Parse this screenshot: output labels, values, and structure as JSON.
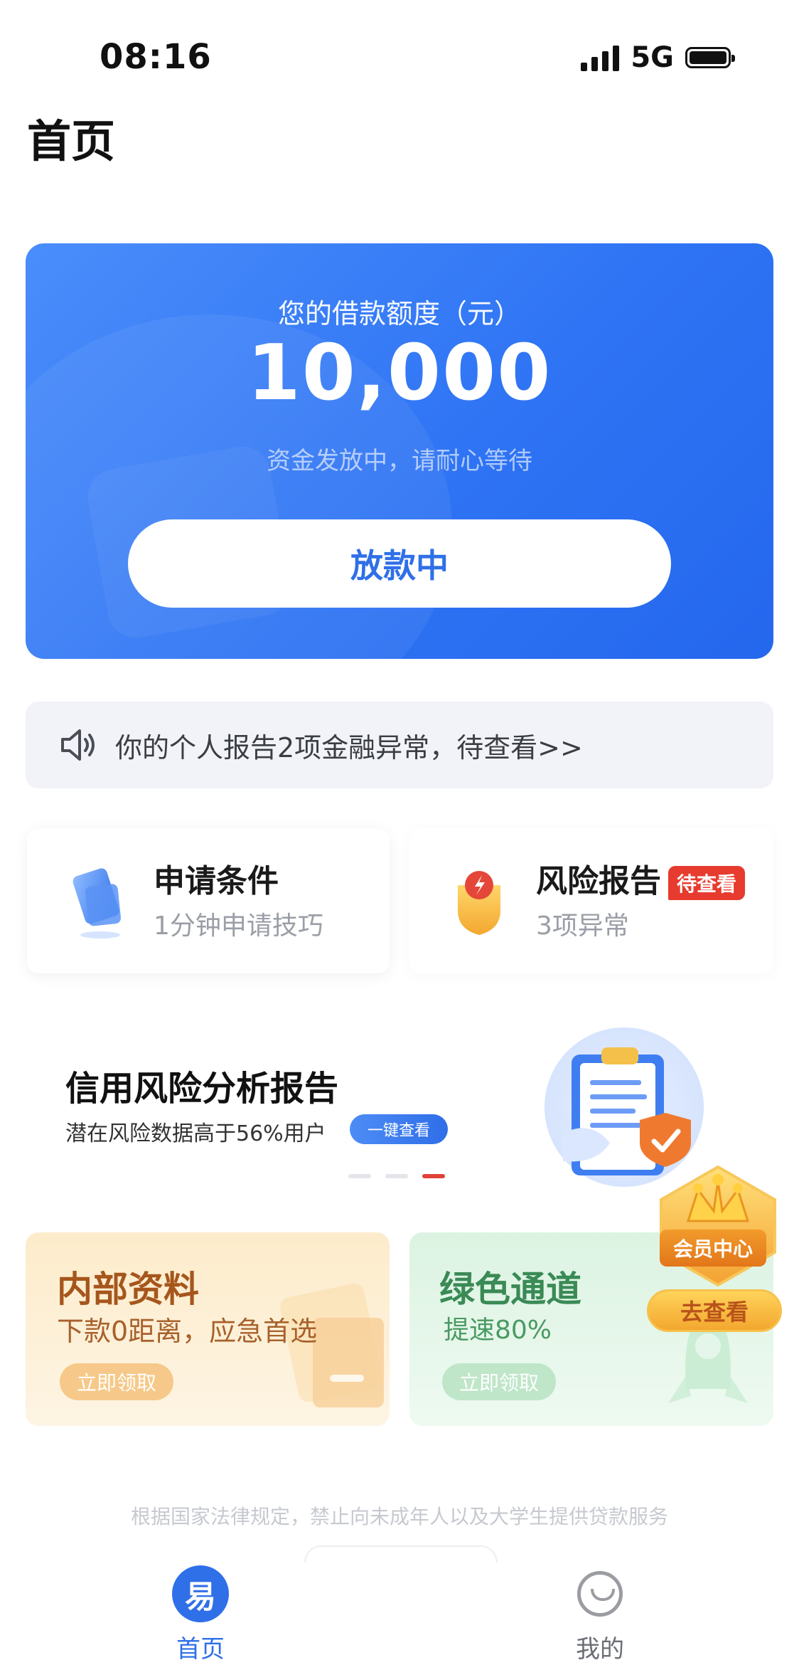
{
  "status_bar": {
    "time": "08:16",
    "network": "5G"
  },
  "page_title": "首页",
  "loan_card": {
    "label": "您的借款额度（元）",
    "amount": "10,000",
    "status_text": "资金发放中，请耐心等待",
    "button_label": "放款中"
  },
  "notice": {
    "text": "你的个人报告2项金融异常，待查看>>"
  },
  "features": [
    {
      "title": "申请条件",
      "subtitle": "1分钟申请技巧"
    },
    {
      "title": "风险报告",
      "badge": "待查看",
      "subtitle": "3项异常"
    }
  ],
  "credit_banner": {
    "title": "信用风险分析报告",
    "subtitle": "潜在风险数据高于56%用户",
    "button_label": "一键查看",
    "active_slide": 3,
    "slide_count": 3
  },
  "promos": [
    {
      "title": "内部资料",
      "subtitle": "下款0距离，应急首选",
      "button_label": "立即领取"
    },
    {
      "title": "绿色通道",
      "subtitle": "提速80%",
      "button_label": "立即领取"
    }
  ],
  "member_center": {
    "label": "会员中心",
    "button_label": "去查看"
  },
  "disclaimer": "根据国家法律规定，禁止向未成年人以及大学生提供贷款服务",
  "tab_bar": {
    "items": [
      {
        "label": "首页",
        "active": true
      },
      {
        "label": "我的",
        "active": false
      }
    ]
  },
  "colors": {
    "primary": "#2f6fe8",
    "alert": "#e63b2e",
    "orange": "#a6561c",
    "green": "#3a8a55"
  }
}
